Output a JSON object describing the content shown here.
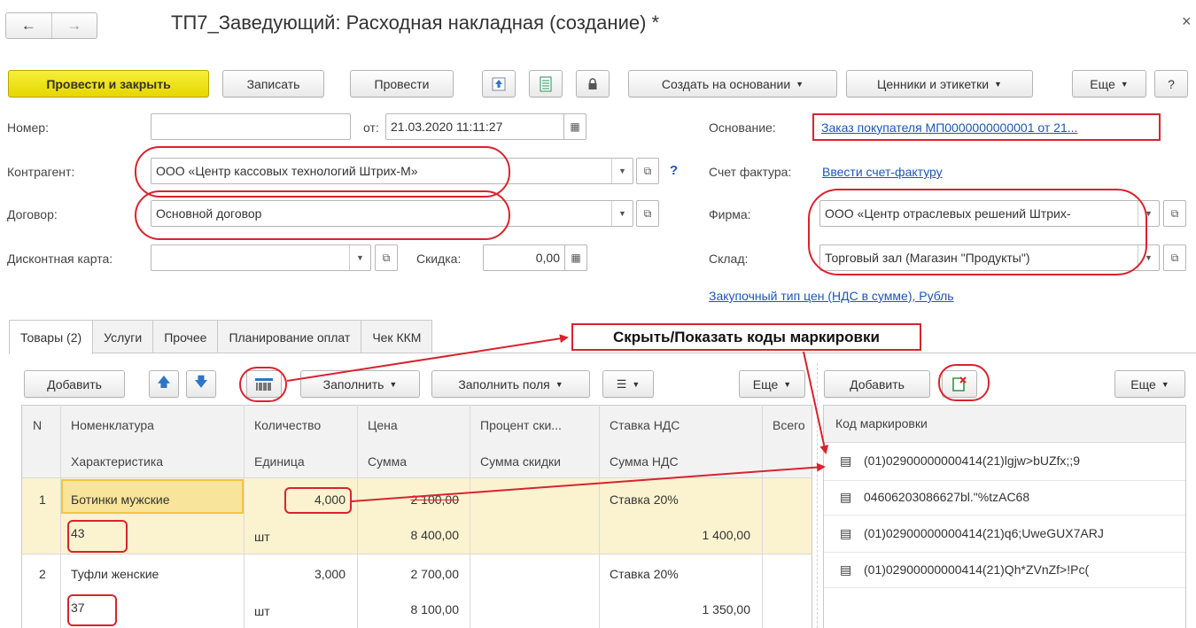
{
  "window": {
    "title": "ТП7_Заведующий: Расходная накладная (создание) *",
    "close_glyph": "×"
  },
  "nav": {
    "back": "←",
    "forward": "→"
  },
  "toolbar": {
    "post_close": "Провести и закрыть",
    "save": "Записать",
    "post": "Провести",
    "create_based": "Создать на основании",
    "price_tags": "Ценники и этикетки",
    "more": "Еще",
    "help": "?"
  },
  "form": {
    "number_label": "Номер:",
    "number_value": "",
    "date_label": "от:",
    "date_value": "21.03.2020 11:11:27",
    "basis_label": "Основание:",
    "basis_value": "Заказ покупателя МП0000000000001 от 21...",
    "contractor_label": "Контрагент:",
    "contractor_value": "ООО «Центр кассовых технологий Штрих-М»",
    "invoice_label": "Счет фактура:",
    "invoice_link": "Ввести счет-фактуру",
    "contract_label": "Договор:",
    "contract_value": "Основной договор",
    "firm_label": "Фирма:",
    "firm_value": "ООО «Центр отраслевых решений Штрих-",
    "discount_card_label": "Дисконтная карта:",
    "discount_card_value": "",
    "discount_label": "Скидка:",
    "discount_value": "0,00",
    "warehouse_label": "Склад:",
    "warehouse_value": "Торговый зал (Магазин \"Продукты\")",
    "price_type_link": "Закупочный тип цен (НДС в сумме), Рубль",
    "help_q": "?"
  },
  "tabs": [
    "Товары (2)",
    "Услуги",
    "Прочее",
    "Планирование оплат",
    "Чек ККМ"
  ],
  "callout": "Скрыть/Показать коды маркировки",
  "goods_toolbar": {
    "add": "Добавить",
    "fill": "Заполнить",
    "fill_fields": "Заполнить поля",
    "more": "Еще"
  },
  "goods_table": {
    "headers_row1": [
      "N",
      "Номенклатура",
      "Количество",
      "Цена",
      "Процент ски...",
      "Ставка НДС",
      "Всего"
    ],
    "headers_row2": [
      "Характеристика",
      "Единица",
      "Сумма",
      "Сумма скидки",
      "Сумма НДС"
    ],
    "rows": [
      {
        "n": "1",
        "name": "Ботинки мужские",
        "qty": "4,000",
        "price": "2 100,00",
        "vat_rate": "Ставка 20%",
        "char": "43",
        "unit": "шт",
        "sum": "8 400,00",
        "vat_sum": "1 400,00"
      },
      {
        "n": "2",
        "name": "Туфли женские",
        "qty": "3,000",
        "price": "2 700,00",
        "vat_rate": "Ставка 20%",
        "char": "37",
        "unit": "шт",
        "sum": "8 100,00",
        "vat_sum": "1 350,00"
      }
    ]
  },
  "marks_toolbar": {
    "add": "Добавить",
    "more": "Еще"
  },
  "marks_table": {
    "header": "Код маркировки",
    "rows": [
      "(01)02900000000414(21)lgjw>bUZfx;;9",
      "04606203086627bl.\"%tzAC68",
      "(01)02900000000414(21)q6;UweGUX7ARJ",
      "(01)02900000000414(21)Qh*ZVnZf>!Pc("
    ]
  },
  "colors": {
    "accent_yellow": "#f0e31a",
    "selected_row": "#fbf3cf",
    "annotation_red": "#d9232f",
    "link_blue": "#1a57b8"
  }
}
